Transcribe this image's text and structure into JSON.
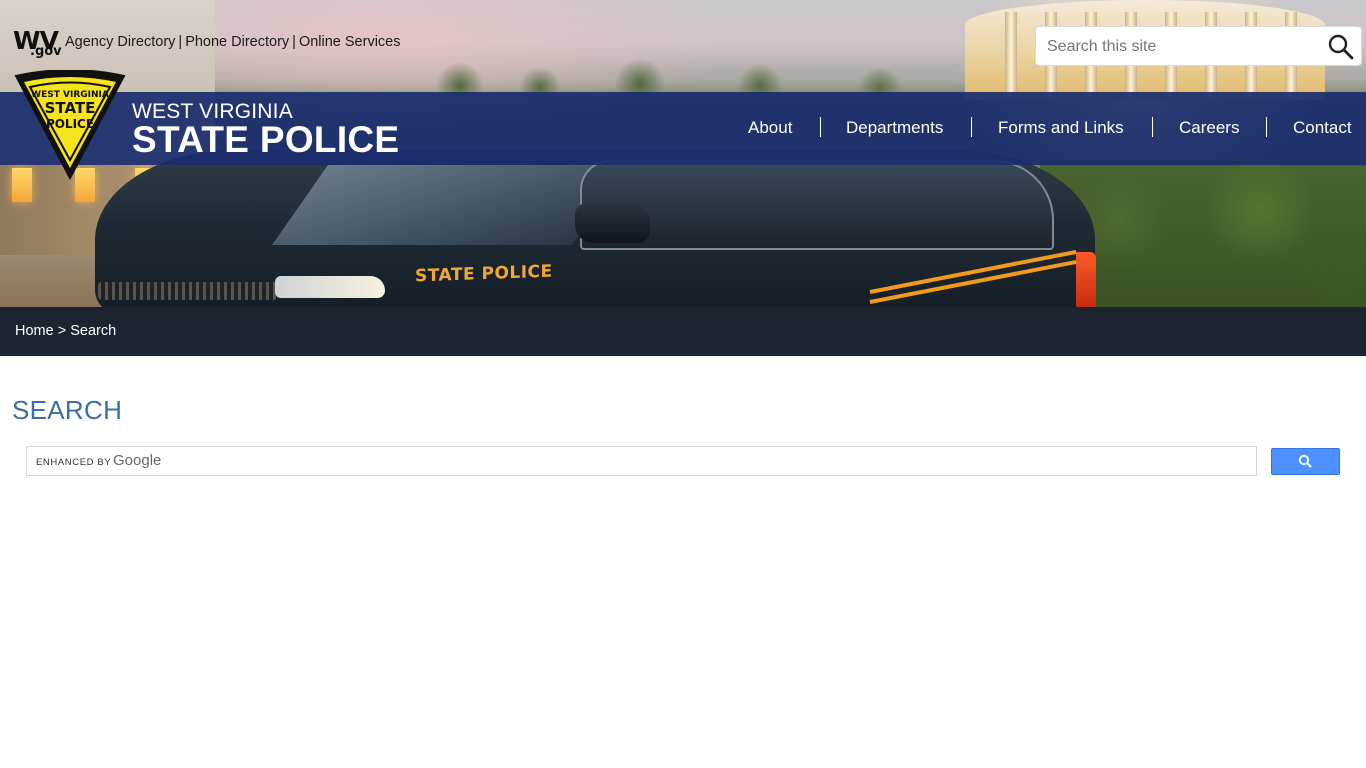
{
  "utility": {
    "logo_main": "WV",
    "logo_sub": ".gov",
    "links": [
      "Agency Directory",
      "Phone Directory",
      "Online Services"
    ],
    "separator": "|"
  },
  "site_search": {
    "placeholder": "Search this site",
    "icon": "magnifier-icon"
  },
  "agency": {
    "subtitle": "WEST VIRGINIA",
    "title": "STATE POLICE",
    "badge_lines": [
      "WEST VIRGINIA",
      "STATE",
      "POLICE"
    ]
  },
  "vehicle_lettering": "STATE POLICE",
  "nav": {
    "items": [
      "About",
      "Departments",
      "Forms and Links",
      "Careers",
      "Contact"
    ]
  },
  "breadcrumb": {
    "home": "Home",
    "separator": ">",
    "current": "Search"
  },
  "page": {
    "title": "SEARCH"
  },
  "google_search": {
    "enhanced_label": "ENHANCED BY",
    "brand": "Google",
    "button_icon": "magnifier-icon",
    "button_color": "#4d90fe"
  },
  "colors": {
    "nav_bar": "#1a2c6e",
    "breadcrumb_bar": "#1e2330",
    "title": "#3b6ea5",
    "badge_yellow": "#f5e31b"
  }
}
